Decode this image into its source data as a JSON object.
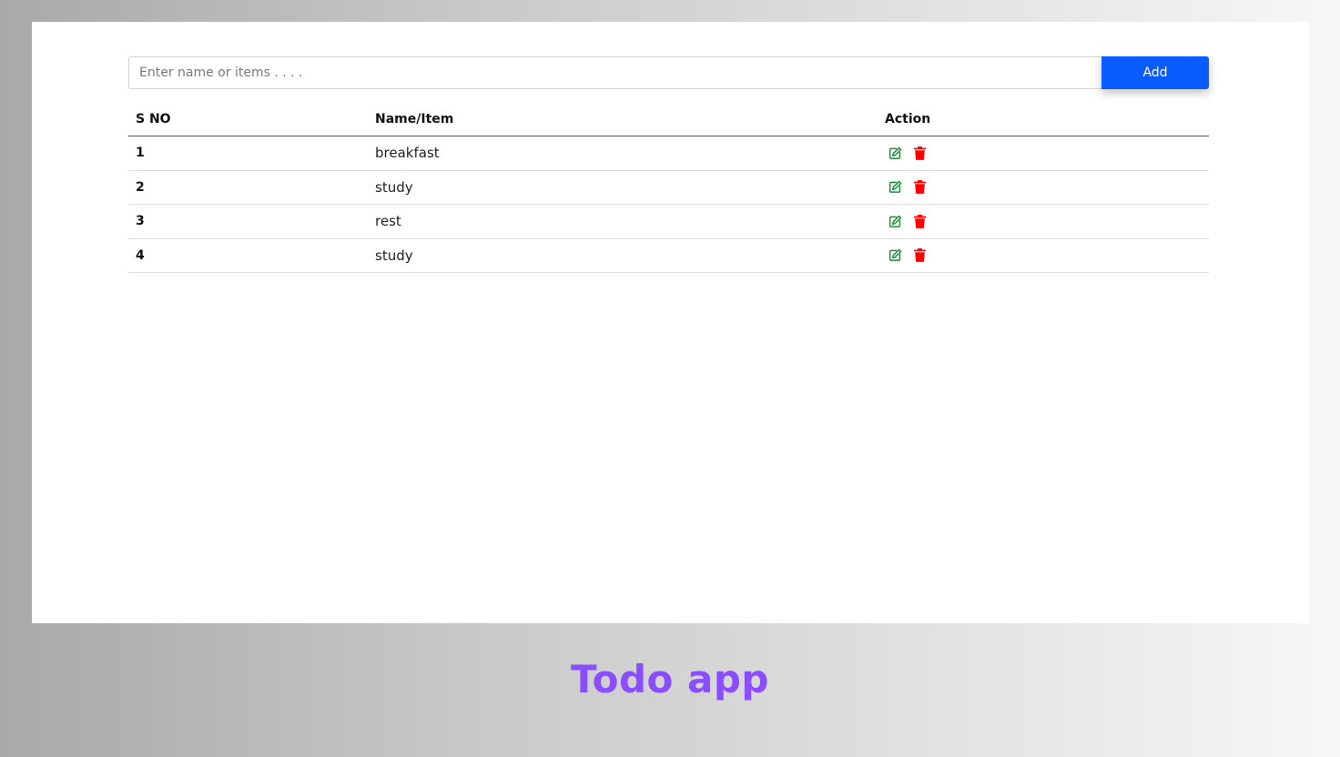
{
  "form": {
    "input_placeholder": "Enter name or items . . . .",
    "input_value": "",
    "add_label": "Add"
  },
  "table": {
    "headers": {
      "sno": "S NO",
      "name": "Name/Item",
      "action": "Action"
    },
    "rows": [
      {
        "sno": "1",
        "name": "breakfast"
      },
      {
        "sno": "2",
        "name": "study"
      },
      {
        "sno": "3",
        "name": "rest"
      },
      {
        "sno": "4",
        "name": "study"
      }
    ],
    "row_actions": [
      "edit-icon",
      "trash-icon"
    ]
  },
  "footer": {
    "title": "Todo app"
  },
  "colors": {
    "accent": "#0b5cff",
    "edit": "#1e8f3a",
    "delete": "#ff0000",
    "title": "#8a4dff"
  }
}
